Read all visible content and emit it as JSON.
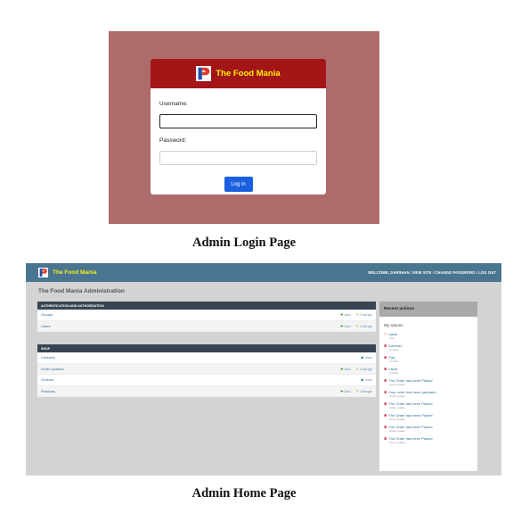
{
  "login": {
    "brand": "The Food Mania",
    "username_label": "Username:",
    "username_value": "",
    "password_label": "Password:",
    "password_value": "",
    "login_button": "Log in"
  },
  "captions": {
    "login": "Admin Login Page",
    "home": "Admin Home Page"
  },
  "admin": {
    "brand": "The Food Mania",
    "user_tools": "WELCOME, DARSHAN. VIEW SITE / CHANGE PASSWORD / LOG OUT",
    "page_title": "The Food Mania Administration",
    "modules": [
      {
        "title": "AUTHENTICATION AND AUTHORIZATION",
        "rows": [
          {
            "name": "Groups",
            "add": "Add",
            "change": "Change"
          },
          {
            "name": "Users",
            "add": "Add",
            "change": "Change"
          }
        ]
      },
      {
        "title": "SHOP",
        "rows": [
          {
            "name": "Contacts",
            "view": "View"
          },
          {
            "name": "Order updates",
            "add": "Add",
            "change": "Change"
          },
          {
            "name": "Orderss",
            "view": "View"
          },
          {
            "name": "Products",
            "add": "Add",
            "change": "Change"
          }
        ]
      }
    ],
    "recent": {
      "title": "Recent actions",
      "subtitle": "My actions",
      "items": [
        {
          "text": "harsh",
          "sub": "User",
          "kind": "change"
        },
        {
          "text": "Darshan",
          "sub": "Contact",
          "kind": "delete"
        },
        {
          "text": "Parj",
          "sub": "Contact",
          "kind": "delete"
        },
        {
          "text": "nisha",
          "sub": "Contact",
          "kind": "delete"
        },
        {
          "text": "The Order has been Placed",
          "sub": "Order update",
          "kind": "delete"
        },
        {
          "text": "Your order has been prepared",
          "sub": "Order update",
          "kind": "delete"
        },
        {
          "text": "The Order has been Placed",
          "sub": "Order update",
          "kind": "delete"
        },
        {
          "text": "The Order has been Placed",
          "sub": "Order update",
          "kind": "delete"
        },
        {
          "text": "The Order has been Placed",
          "sub": "Order update",
          "kind": "delete"
        },
        {
          "text": "The Order has been Placed",
          "sub": "Order update",
          "kind": "delete"
        }
      ]
    }
  },
  "colors": {
    "login_backdrop": "#ad6b6b",
    "login_header": "#a31618",
    "brand_yellow": "#fff200",
    "admin_header": "#4a7590",
    "module_header": "#374552",
    "button_blue": "#1a5fe0"
  },
  "icons": {
    "brand_logo": "p-logo-icon",
    "add": "plus-icon",
    "change": "pencil-icon",
    "view": "eye-icon",
    "delete": "x-icon"
  }
}
